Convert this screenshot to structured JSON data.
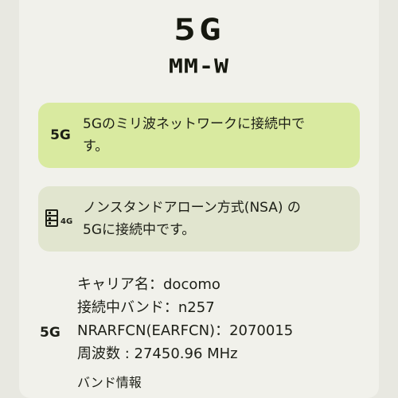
{
  "header": {
    "title": "5G",
    "subtitle": "MM-W"
  },
  "mmwave_card": {
    "icon": "5g-icon",
    "icon_text": "5G",
    "line1": "5Gのミリ波ネットワークに接続中で",
    "line2": "す。"
  },
  "nsa_card": {
    "icon": "4g-signal-icon",
    "icon_text": "4G",
    "line1": "ノンスタンドアローン方式(NSA) の",
    "line2": "5Gに接続中です。"
  },
  "details": {
    "icon_text": "5G",
    "carrier": "キャリア名：docomo",
    "band": "接続中バンド：n257",
    "nrarfcn": "NRARFCN(EARFCN)：2070015",
    "frequency": "周波数 : 27450.96 MHz",
    "band_info_link": "バンド情報"
  },
  "colors": {
    "background": "#f1f1eb",
    "primary_card": "#d9eaa0",
    "secondary_card": "#e1e5cf",
    "text": "#1d1f17"
  }
}
